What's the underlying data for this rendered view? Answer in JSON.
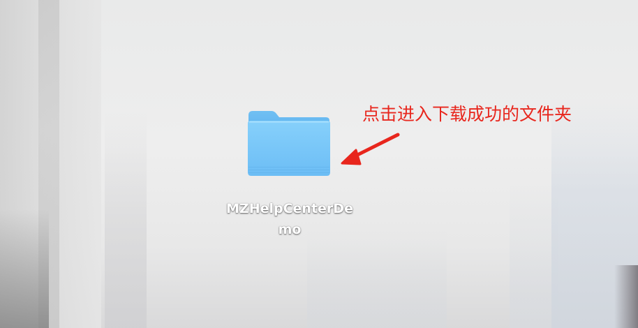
{
  "desktop": {
    "folder": {
      "name_line1": "MZHelpCenterDe",
      "name_line2": "mo",
      "icon": "folder-icon",
      "color": "#7cc8f8"
    }
  },
  "annotation": {
    "text": "点击进入下载成功的文件夹",
    "color": "#e8261d",
    "icon": "arrow-icon"
  }
}
